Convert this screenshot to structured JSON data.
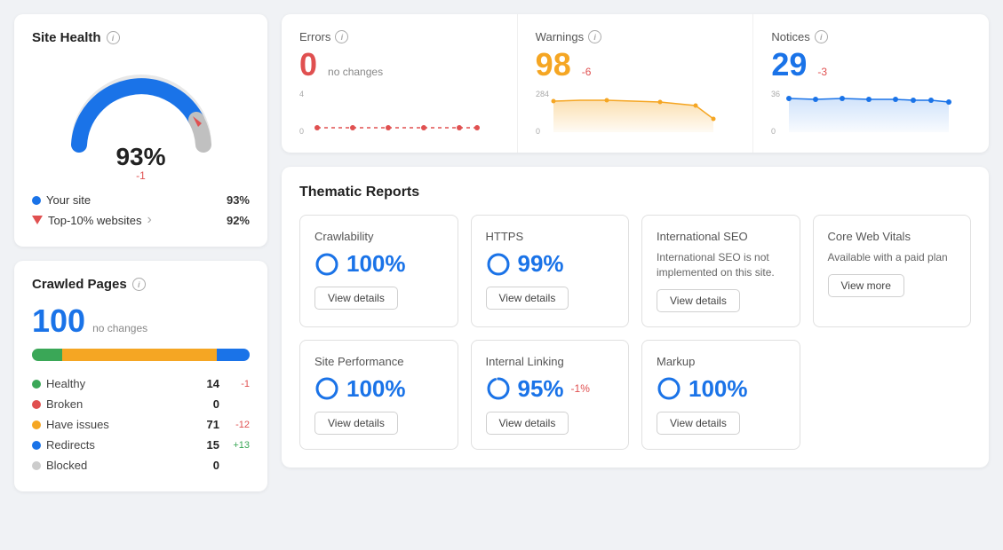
{
  "site_health": {
    "title": "Site Health",
    "percent": "93%",
    "delta": "-1",
    "your_site_label": "Your site",
    "your_site_val": "93%",
    "top10_label": "Top-10% websites",
    "top10_val": "92%"
  },
  "crawled_pages": {
    "title": "Crawled Pages",
    "count": "100",
    "sub": "no changes",
    "stats": [
      {
        "label": "Healthy",
        "dot": "#3aa757",
        "count": "14",
        "delta": "-1",
        "delta_class": "delta-neg"
      },
      {
        "label": "Broken",
        "dot": "#e05050",
        "count": "0",
        "delta": "",
        "delta_class": ""
      },
      {
        "label": "Have issues",
        "dot": "#f5a623",
        "count": "71",
        "delta": "-12",
        "delta_class": "delta-neg"
      },
      {
        "label": "Redirects",
        "dot": "#1a73e8",
        "count": "15",
        "delta": "+13",
        "delta_class": "delta-pos"
      },
      {
        "label": "Blocked",
        "dot": "#cccccc",
        "count": "0",
        "delta": "",
        "delta_class": ""
      }
    ],
    "bar": [
      {
        "pct": 14,
        "color": "#3aa757"
      },
      {
        "pct": 71,
        "color": "#f5a623"
      },
      {
        "pct": 15,
        "color": "#1a73e8"
      }
    ]
  },
  "metrics": {
    "errors": {
      "title": "Errors",
      "value": "0",
      "delta": "no changes",
      "delta_class": "metric-sub",
      "value_class": "errors",
      "chart_max": "4",
      "chart_min": "0"
    },
    "warnings": {
      "title": "Warnings",
      "value": "98",
      "delta": "-6",
      "delta_class": "neg",
      "value_class": "warnings",
      "chart_max": "284",
      "chart_min": "0"
    },
    "notices": {
      "title": "Notices",
      "value": "29",
      "delta": "-3",
      "delta_class": "neg",
      "value_class": "notices",
      "chart_max": "36",
      "chart_min": "0"
    }
  },
  "thematic": {
    "title": "Thematic Reports",
    "reports_row1": [
      {
        "name": "Crawlability",
        "score": "100%",
        "delta": "",
        "desc": "",
        "btn": "View details",
        "has_score": true
      },
      {
        "name": "HTTPS",
        "score": "99%",
        "delta": "",
        "desc": "",
        "btn": "View details",
        "has_score": true
      },
      {
        "name": "International SEO",
        "score": "",
        "delta": "",
        "desc": "International SEO is not implemented on this site.",
        "btn": "View details",
        "has_score": false
      },
      {
        "name": "Core Web Vitals",
        "score": "",
        "delta": "",
        "desc": "Available with a paid plan",
        "btn": "View more",
        "has_score": false
      }
    ],
    "reports_row2": [
      {
        "name": "Site Performance",
        "score": "100%",
        "delta": "",
        "desc": "",
        "btn": "View details",
        "has_score": true
      },
      {
        "name": "Internal Linking",
        "score": "95%",
        "delta": "-1%",
        "desc": "",
        "btn": "View details",
        "has_score": true
      },
      {
        "name": "Markup",
        "score": "100%",
        "delta": "",
        "desc": "",
        "btn": "View details",
        "has_score": true
      }
    ]
  }
}
